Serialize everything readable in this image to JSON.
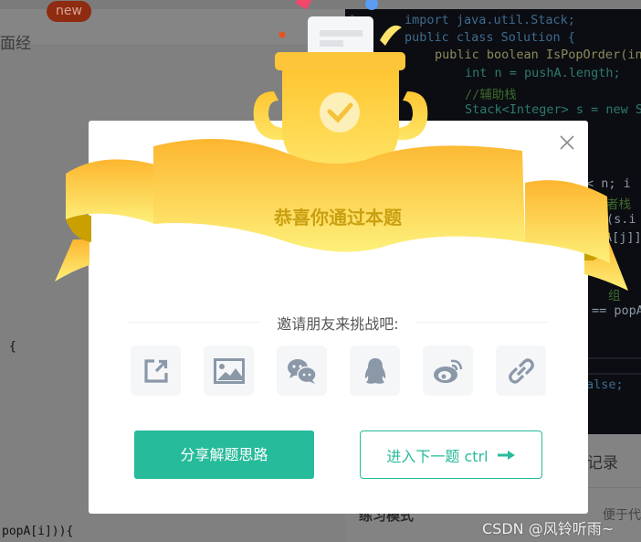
{
  "background": {
    "tab_label": "面经",
    "new_badge": "new",
    "left_code": [
      "{",
      "popA[i])){"
    ],
    "editor": {
      "line_numbers": [
        "1"
      ],
      "lines": [
        "import java.util.Stack;",
        "public class Solution {",
        "public boolean IsPopOrder(in",
        "int n = pushA.length;",
        "//辅助栈",
        "Stack<Integer> s = new S"
      ],
      "fragments": [
        "< n; i",
        "者栈",
        "(s.i",
        "A[j]]",
        "组",
        "== popA",
        "alse;"
      ]
    },
    "record_tab": "记录",
    "mode_label": "练习模式",
    "mode_desc": "便于代",
    "watermark": "CSDN @风铃听雨~"
  },
  "modal": {
    "title": "恭喜你通过本题",
    "invite_text": "邀请朋友来挑战吧:",
    "share_icons": [
      "share-external-icon",
      "image-icon",
      "wechat-icon",
      "qq-icon",
      "weibo-icon",
      "link-icon"
    ],
    "share_button": "分享解题思路",
    "next_button": "进入下一题 ctrl",
    "colors": {
      "primary": "#26bb9a",
      "gold": "#fbc02d",
      "icon": "#8a98a8"
    }
  }
}
